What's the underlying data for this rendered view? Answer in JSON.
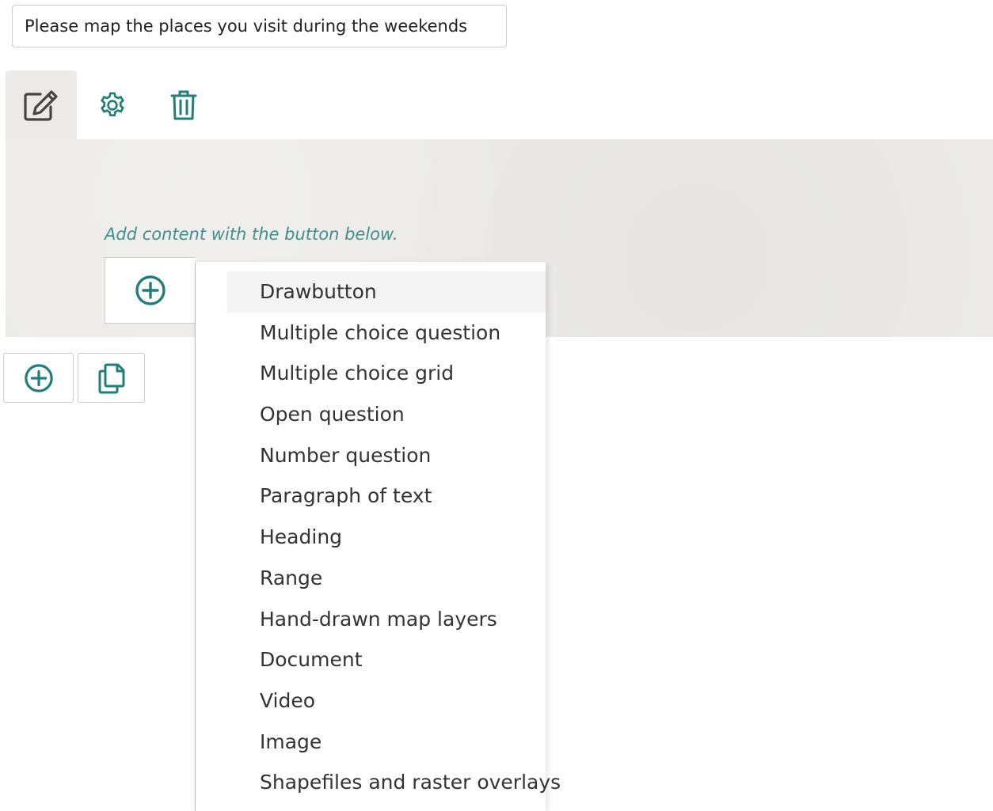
{
  "question": {
    "title_value": "Please map the places you visit during the weekends"
  },
  "tabs": [
    {
      "icon": "edit-icon",
      "active": true
    },
    {
      "icon": "gear-icon",
      "active": false
    },
    {
      "icon": "trash-icon",
      "active": false
    }
  ],
  "content": {
    "hint": "Add content with the button below."
  },
  "add_menu": {
    "items": [
      {
        "label": "Drawbutton",
        "highlighted": true
      },
      {
        "label": "Multiple choice question"
      },
      {
        "label": "Multiple choice grid"
      },
      {
        "label": "Open question"
      },
      {
        "label": "Number question"
      },
      {
        "label": "Paragraph of text"
      },
      {
        "label": "Heading"
      },
      {
        "label": "Range"
      },
      {
        "label": "Hand-drawn map layers"
      },
      {
        "label": "Document"
      },
      {
        "label": "Video"
      },
      {
        "label": "Image"
      },
      {
        "label": "Shapefiles and raster overlays"
      }
    ]
  },
  "colors": {
    "accent": "#1f7f7a",
    "hint_text": "#3f8f8f",
    "panel_bg": "#ebeae6"
  }
}
